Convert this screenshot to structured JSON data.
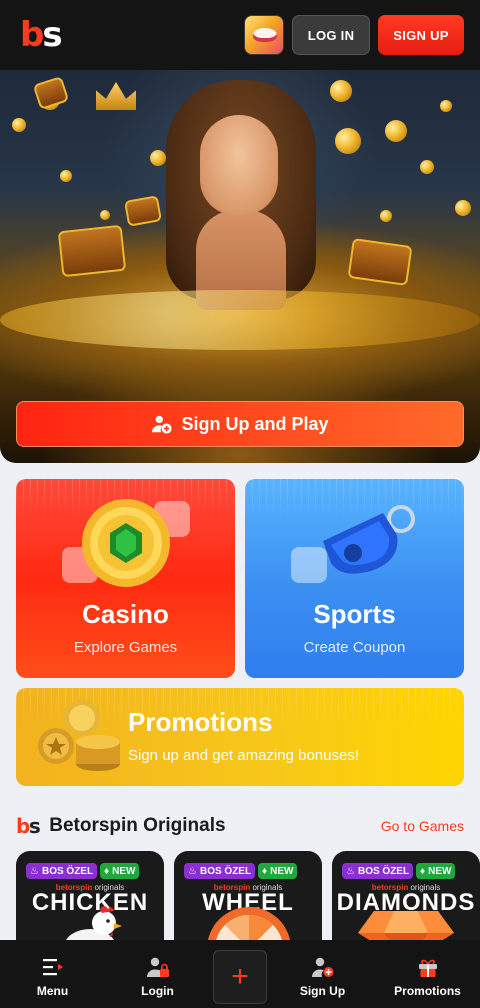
{
  "header": {
    "logo_b": "b",
    "logo_s": "s",
    "login_label": "LOG IN",
    "signup_label": "SIGN UP"
  },
  "hero": {
    "cta_label": "Sign Up and Play"
  },
  "cards": {
    "casino": {
      "title": "Casino",
      "subtitle": "Explore Games"
    },
    "sports": {
      "title": "Sports",
      "subtitle": "Create Coupon"
    },
    "promotions": {
      "title": "Promotions",
      "subtitle": "Sign up and get amazing bonuses!"
    }
  },
  "originals": {
    "logo_b": "b",
    "logo_s": "s",
    "title": "Betorspin Originals",
    "link_label": "Go to Games",
    "games": [
      {
        "badge_special": "BOS ÖZEL",
        "badge_new": "NEW",
        "brand_bold": "betorspin",
        "brand_rest": " originals",
        "name": "CHICKEN"
      },
      {
        "badge_special": "BOS ÖZEL",
        "badge_new": "NEW",
        "brand_bold": "betorspin",
        "brand_rest": " originals",
        "name": "WHEEL"
      },
      {
        "badge_special": "BOS ÖZEL",
        "badge_new": "NEW",
        "brand_bold": "betorspin",
        "brand_rest": " originals",
        "name": "DIAMONDS"
      }
    ]
  },
  "bottom_nav": {
    "items": [
      {
        "label": "Menu",
        "icon": "menu-icon"
      },
      {
        "label": "Login",
        "icon": "user-lock-icon"
      },
      {
        "label": "+",
        "icon": "plus-icon"
      },
      {
        "label": "Sign Up",
        "icon": "user-add-icon"
      },
      {
        "label": "Promotions",
        "icon": "gift-icon"
      }
    ]
  },
  "colors": {
    "brand_red": "#ff3b1f",
    "header_bg": "#141414",
    "casino_bg": "#ff2a12",
    "sports_bg": "#3b8ff0",
    "promo_bg": "#f7c71a"
  }
}
